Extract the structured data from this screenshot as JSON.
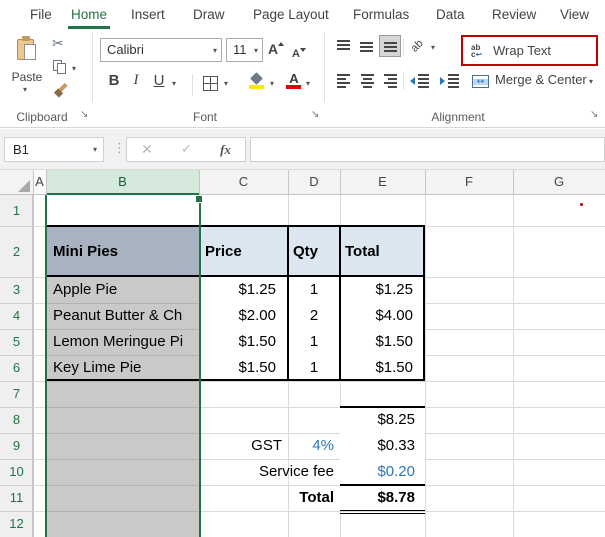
{
  "ribbon": {
    "tabs": [
      {
        "label": "File"
      },
      {
        "label": "Home",
        "active": true
      },
      {
        "label": "Insert"
      },
      {
        "label": "Draw"
      },
      {
        "label": "Page Layout"
      },
      {
        "label": "Formulas"
      },
      {
        "label": "Data"
      },
      {
        "label": "Review"
      },
      {
        "label": "View"
      }
    ],
    "clipboard": {
      "paste_label": "Paste",
      "group_label": "Clipboard"
    },
    "font": {
      "font_name": "Calibri",
      "font_size": "11",
      "bold": "B",
      "italic": "I",
      "underline": "U",
      "grow_font": "A",
      "shrink_font": "A",
      "group_label": "Font"
    },
    "alignment": {
      "wrap_text_label": "Wrap Text",
      "merge_center_label": "Merge & Center",
      "group_label": "Alignment",
      "wrap_icon_top": "ab",
      "wrap_icon_bottom": "c",
      "orientation_glyph": "ab"
    }
  },
  "formula_bar": {
    "name_box_value": "B1",
    "fx_label": "fx"
  },
  "icons": {
    "dropdown": "▾",
    "cut": "✂",
    "dots": "⋮",
    "cancel": "✕",
    "confirm": "✓",
    "launcher": "↘",
    "wrap_return": "↩",
    "merge_arrows": "↔"
  },
  "sheet": {
    "selected_column": "B",
    "active_cell": "B1",
    "column_headers": [
      "A",
      "B",
      "C",
      "D",
      "E",
      "F",
      "G"
    ],
    "row_headers": [
      "1",
      "2",
      "3",
      "4",
      "5",
      "6",
      "7",
      "8",
      "9",
      "10",
      "11",
      "12"
    ],
    "table": {
      "headers": {
        "name": "Mini Pies",
        "price": "Price",
        "qty": "Qty",
        "total": "Total"
      },
      "rows": [
        {
          "name": "Apple Pie",
          "price": "$1.25",
          "qty": "1",
          "total": "$1.25"
        },
        {
          "name": "Peanut Butter & Ch",
          "price": "$2.00",
          "qty": "2",
          "total": "$4.00"
        },
        {
          "name": "Lemon Meringue Pi",
          "price": "$1.50",
          "qty": "1",
          "total": "$1.50"
        },
        {
          "name": "Key Lime Pie",
          "price": "$1.50",
          "qty": "1",
          "total": "$1.50"
        }
      ]
    },
    "summary": {
      "subtotal": "$8.25",
      "gst_label": "GST",
      "gst_rate": "4%",
      "gst_amount": "$0.33",
      "service_label": "Service fee",
      "service_amount": "$0.20",
      "total_label": "Total",
      "total_amount": "$8.78"
    }
  },
  "colors": {
    "accent_green": "#217346",
    "highlight_red": "#C00000",
    "blue_value_text": "#2E75B6",
    "table_header_fill": "#DCE6F1",
    "selected_column_fill": "#C9C9C9",
    "selected_header_cell_fill": "#A8B2C0"
  }
}
